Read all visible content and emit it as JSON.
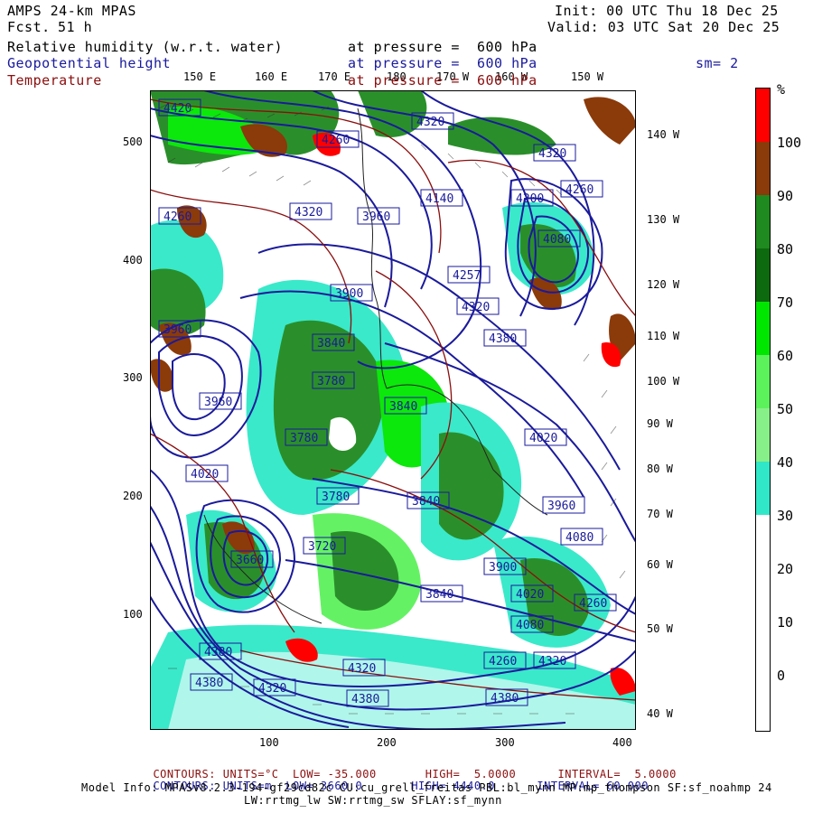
{
  "header": {
    "model": "AMPS 24-km MPAS",
    "fcst_label": "Fcst.",
    "fcst_value": "51 h",
    "init": "Init: 00 UTC Thu 18 Dec 25",
    "valid": "Valid: 03 UTC Sat 20 Dec 25"
  },
  "fields": [
    {
      "name": "Relative humidity (w.r.t. water)",
      "level": "at pressure =  600 hPa",
      "color": "#000000"
    },
    {
      "name": "Geopotential height",
      "level": "at pressure =  600 hPa",
      "color": "#1a1a9c"
    },
    {
      "name": "Temperature",
      "level": "at pressure =  600 hPa",
      "color": "#8b0e0e"
    }
  ],
  "smoothing": "sm= 2",
  "top_lon_labels": [
    "150 E",
    "160 E",
    "170 E",
    "180",
    "170 W",
    "160 W",
    "150 W"
  ],
  "right_lon_labels": [
    "140 W",
    "130 W",
    "120 W",
    "110 W",
    "100 W",
    "90 W",
    "80 W",
    "70 W",
    "60 W",
    "50 W",
    "40 W"
  ],
  "x_ticks": [
    "100",
    "200",
    "300",
    "400"
  ],
  "y_ticks": [
    "500",
    "400",
    "300",
    "200",
    "100"
  ],
  "colorbar": {
    "unit": "%",
    "labels": [
      "100",
      "90",
      "80",
      "70",
      "60",
      "50",
      "40",
      "30",
      "20",
      "10",
      "0"
    ],
    "colors": [
      "#ff0000",
      "#8b3a0a",
      "#1f8a1f",
      "#0e6a0e",
      "#00e600",
      "#5cf25c",
      "#88f088",
      "#30e8c8",
      "#ffffff",
      "#ffffff",
      "#ffffff",
      "#ffffff"
    ]
  },
  "contour_labels": [
    "4420",
    "4380",
    "4320",
    "4260",
    "4200",
    "4140",
    "4080",
    "4020",
    "3960",
    "3900",
    "3840",
    "3780",
    "3720",
    "3660",
    "4257",
    "4320",
    "4380"
  ],
  "footer": {
    "temp_line": {
      "label": "CONTOURS:",
      "units": "UNITS=°C",
      "low": "LOW= -35.000",
      "high": "HIGH=  5.0000",
      "interval": "INTERVAL=  5.0000"
    },
    "hgt_line": {
      "label": "CONTOURS:",
      "units": "UNITS=m",
      "low": "LOW= 3660.0",
      "high": "HIGH= 4440.0",
      "interval": "INTERVAL= 60.000"
    },
    "model_info": "Model Info: MPASv8.2.3-194-gf29cd82c CU:cu_grell_freitas PBL:bl_mynn MP:mp_thompson SF:sf_noahmp 24",
    "model_info2": "LW:rrtmg_lw SW:rrtmg_sw SFLAY:sf_mynn"
  }
}
